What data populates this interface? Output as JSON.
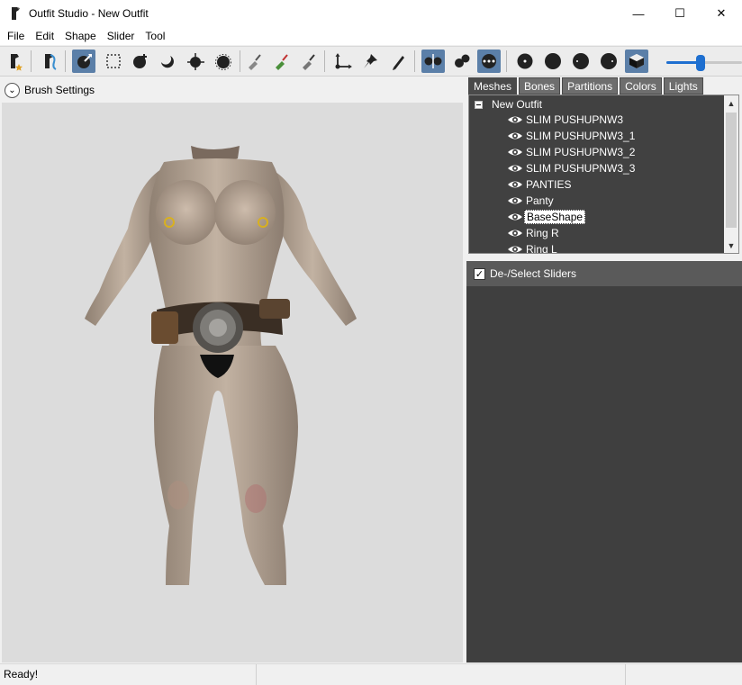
{
  "window": {
    "title": "Outfit Studio - New Outfit",
    "minimize": "—",
    "maximize": "☐",
    "close": "✕"
  },
  "menu": [
    "File",
    "Edit",
    "Shape",
    "Slider",
    "Tool"
  ],
  "toolbar": {
    "buttons": [
      {
        "name": "new-project-icon",
        "active": false
      },
      {
        "name": "load-reference-icon",
        "active": false
      },
      {
        "name": "select-brush-icon",
        "active": true
      },
      {
        "name": "mask-select-icon",
        "active": false
      },
      {
        "name": "inflate-brush-icon",
        "active": false
      },
      {
        "name": "deflate-brush-icon",
        "active": false
      },
      {
        "name": "move-brush-icon",
        "active": false
      },
      {
        "name": "smooth-brush-icon",
        "active": false
      },
      {
        "name": "mask-brush-icon",
        "active": false
      },
      {
        "name": "weight-brush-icon",
        "active": false
      },
      {
        "name": "color-brush-icon",
        "active": false
      },
      {
        "name": "transform-icon",
        "active": false
      },
      {
        "name": "pivot-icon",
        "active": false
      },
      {
        "name": "vertex-edit-icon",
        "active": false
      },
      {
        "name": "x-mirror-icon",
        "active": true
      },
      {
        "name": "connected-only-icon",
        "active": false
      },
      {
        "name": "global-brush-icon",
        "active": true
      },
      {
        "name": "show-vertices-icon",
        "active": false
      },
      {
        "name": "show-wireframe-icon",
        "active": false
      },
      {
        "name": "show-lighting-icon",
        "active": false
      },
      {
        "name": "show-textures-icon",
        "active": false
      },
      {
        "name": "show-mask-icon",
        "active": true
      }
    ],
    "brush_size": 0.45
  },
  "brush_settings": {
    "label": "Brush Settings",
    "toggle": "⌄"
  },
  "tabs": [
    {
      "label": "Meshes",
      "active": true
    },
    {
      "label": "Bones",
      "active": false
    },
    {
      "label": "Partitions",
      "active": false
    },
    {
      "label": "Colors",
      "active": false
    },
    {
      "label": "Lights",
      "active": false
    }
  ],
  "tree": {
    "root": "New Outfit",
    "items": [
      {
        "label": "SLIM PUSHUPNW3",
        "selected": false
      },
      {
        "label": "SLIM PUSHUPNW3_1",
        "selected": false
      },
      {
        "label": "SLIM PUSHUPNW3_2",
        "selected": false
      },
      {
        "label": "SLIM PUSHUPNW3_3",
        "selected": false
      },
      {
        "label": "PANTIES",
        "selected": false
      },
      {
        "label": "Panty",
        "selected": false
      },
      {
        "label": "BaseShape",
        "selected": true
      },
      {
        "label": "Ring R",
        "selected": false
      },
      {
        "label": "Ring L",
        "selected": false
      }
    ],
    "scroll_up": "▲",
    "scroll_down": "▼"
  },
  "sliders": {
    "label": "De-/Select Sliders",
    "checked": true,
    "check_mark": "✓"
  },
  "status": {
    "text": "Ready!"
  },
  "colors": {
    "active_button": "#5b7fa8",
    "panel_dark": "#3f3f3f",
    "accent": "#1e6fd0"
  }
}
